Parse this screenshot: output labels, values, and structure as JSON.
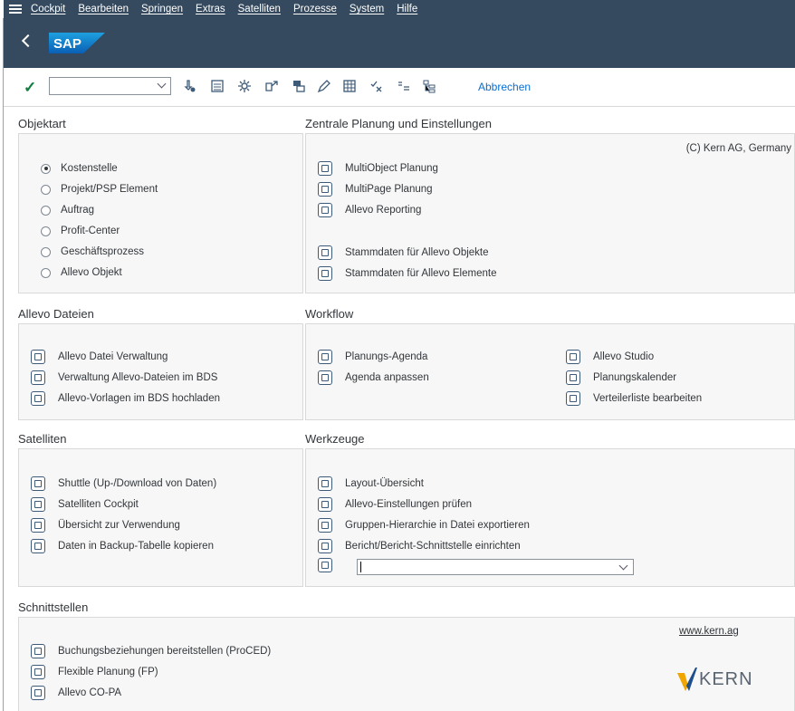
{
  "menu": [
    "Cockpit",
    "Bearbeiten",
    "Springen",
    "Extras",
    "Satelliten",
    "Prozesse",
    "System",
    "Hilfe"
  ],
  "brand": "SAP",
  "toolbar": {
    "command_value": "",
    "icons": [
      "download-icon",
      "list-icon",
      "settings-icon",
      "share-icon",
      "table-icon",
      "edit-icon",
      "grid-icon",
      "check-x-icon",
      "sort-icon",
      "hierarchy-icon"
    ],
    "cancel_label": "Abbrechen"
  },
  "objektart": {
    "title": "Objektart",
    "options": [
      "Kostenstelle",
      "Projekt/PSP Element",
      "Auftrag",
      "Profit-Center",
      "Geschäftsprozess",
      "Allevo Objekt"
    ],
    "selected": "Kostenstelle"
  },
  "zentrale": {
    "title": "Zentrale Planung und Einstellungen",
    "copyright": "(C) Kern AG, Germany",
    "items": [
      "MultiObject Planung",
      "MultiPage Planung",
      "Allevo Reporting",
      "Stammdaten für Allevo Objekte",
      "Stammdaten für Allevo Elemente"
    ]
  },
  "dateien": {
    "title": "Allevo Dateien",
    "items": [
      "Allevo Datei Verwaltung",
      "Verwaltung Allevo-Dateien im BDS",
      "Allevo-Vorlagen im BDS hochladen"
    ]
  },
  "workflow": {
    "title": "Workflow",
    "left": [
      "Planungs-Agenda",
      "Agenda anpassen"
    ],
    "right": [
      "Allevo Studio",
      "Planungskalender",
      "Verteilerliste bearbeiten"
    ]
  },
  "satelliten": {
    "title": "Satelliten",
    "items": [
      "Shuttle (Up-/Download von Daten)",
      "Satelliten Cockpit",
      "Übersicht zur Verwendung",
      "Daten in Backup-Tabelle kopieren"
    ]
  },
  "werkzeuge": {
    "title": "Werkzeuge",
    "items": [
      "Layout-Übersicht",
      "Allevo-Einstellungen prüfen",
      "Gruppen-Hierarchie in Datei exportieren",
      "Bericht/Bericht-Schnittstelle einrichten"
    ],
    "dropdown_value": ""
  },
  "schnittstellen": {
    "title": "Schnittstellen",
    "link": "www.kern.ag",
    "items": [
      "Buchungsbeziehungen bereitstellen (ProCED)",
      "Flexible Planung (FP)",
      "Allevo CO-PA"
    ],
    "logo_text": "KERN"
  },
  "colors": {
    "shell": "#354a5f",
    "accent": "#0a6ed1",
    "check": "#107e3e",
    "kern_orange": "#f0a500",
    "kern_blue": "#1f4e8c"
  }
}
